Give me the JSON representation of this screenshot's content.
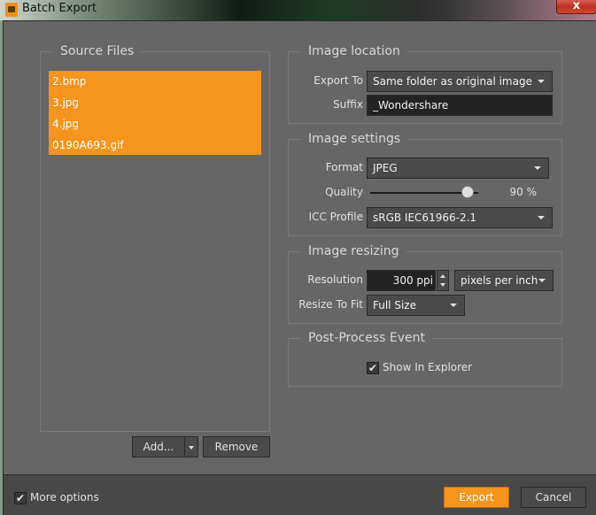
{
  "window": {
    "title": "Batch Export",
    "close_label": "x"
  },
  "source_files": {
    "title": "Source Files",
    "items": [
      "2.bmp",
      "3.jpg",
      "4.jpg",
      "0190A693.gif"
    ],
    "selection_color": "#f7941d",
    "add_label": "Add...",
    "remove_label": "Remove"
  },
  "image_location": {
    "title": "Image location",
    "export_to_label": "Export To",
    "export_to_value": "Same folder as original image",
    "suffix_label": "Suffix",
    "suffix_value": "_Wondershare"
  },
  "image_settings": {
    "title": "Image settings",
    "format_label": "Format",
    "format_value": "JPEG",
    "quality_label": "Quality",
    "quality_value": 90,
    "quality_text": "90 %",
    "icc_label": "ICC Profile",
    "icc_value": "sRGB IEC61966-2.1"
  },
  "image_resizing": {
    "title": "Image resizing",
    "resolution_label": "Resolution",
    "resolution_value": "300 ppi",
    "resolution_unit": "pixels per inch",
    "resize_label": "Resize To Fit",
    "resize_value": "Full Size"
  },
  "post_process": {
    "title": "Post-Process Event",
    "show_in_explorer_label": "Show In Explorer",
    "show_in_explorer_checked": true
  },
  "footer": {
    "more_options_label": "More options",
    "more_options_checked": true,
    "export_label": "Export",
    "cancel_label": "Cancel",
    "accent_color": "#f7941d"
  }
}
